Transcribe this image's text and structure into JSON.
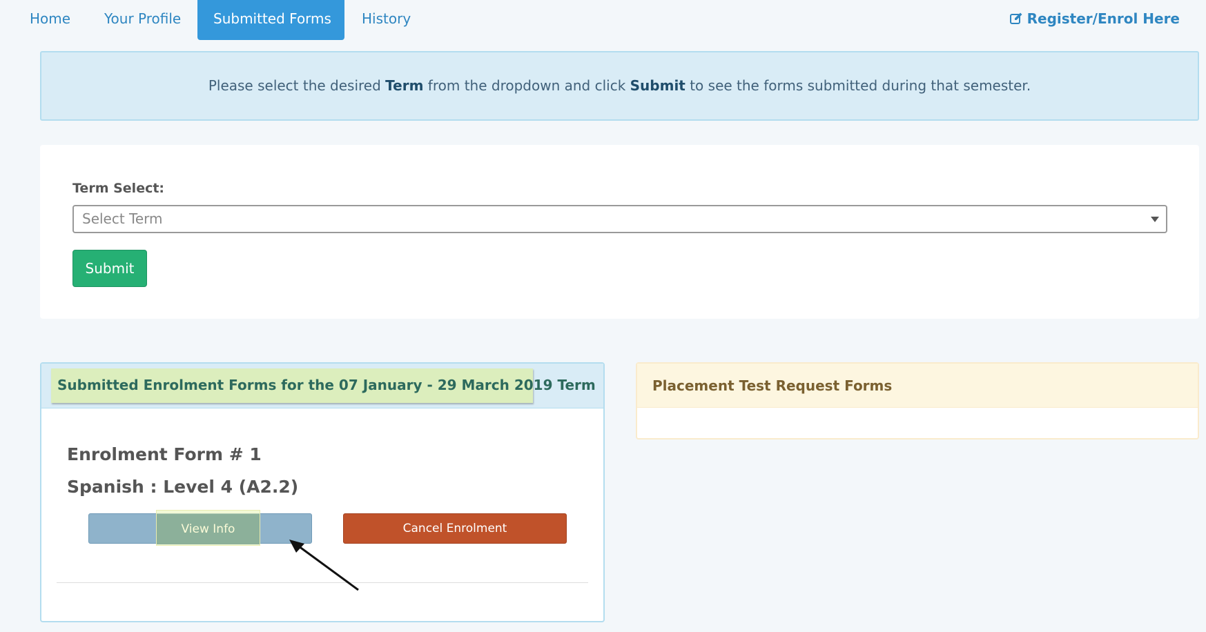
{
  "nav": {
    "tabs": [
      {
        "label": "Home"
      },
      {
        "label": "Your Profile"
      },
      {
        "label": "Submitted Forms",
        "active": true
      },
      {
        "label": "History"
      }
    ],
    "register_label": "Register/Enrol Here",
    "register_icon": "edit-icon"
  },
  "info": {
    "text_before_term": "Please select the desired ",
    "term_word": "Term",
    "text_middle": " from the dropdown and click ",
    "submit_word": "Submit",
    "text_after": " to see the forms submitted during that semester."
  },
  "term_select": {
    "label": "Term Select:",
    "placeholder": "Select Term",
    "submit_label": "Submit"
  },
  "enrolment": {
    "heading": "Submitted Enrolment Forms for the 07 January - 29 March 2019 Term",
    "form_number": "Enrolment Form # 1",
    "course": "Spanish : Level 4 (A2.2)",
    "view_info_label": "View Info",
    "cancel_label": "Cancel Enrolment"
  },
  "placement": {
    "heading": "Placement Test Request Forms"
  },
  "colors": {
    "brand_blue": "#3498db",
    "submit_green": "#26b074",
    "cancel_red": "#c0522a",
    "info_bg": "#d9ecf6",
    "warning_bg": "#fdf6e0"
  }
}
